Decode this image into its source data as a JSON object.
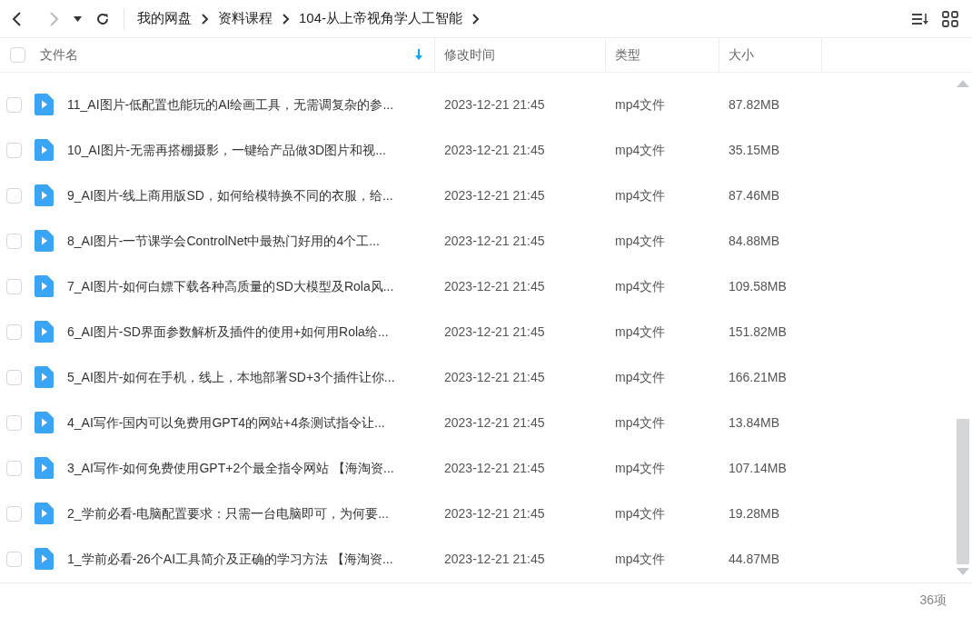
{
  "breadcrumb": [
    "我的网盘",
    "资料课程",
    "104-从上帝视角学人工智能"
  ],
  "header": {
    "checked": false,
    "columns": [
      "文件名",
      "修改时间",
      "类型",
      "大小"
    ]
  },
  "rows": [
    {
      "checked": false,
      "name": "11_AI图片-低配置也能玩的AI绘画工具，无需调复杂的参...",
      "modified": "2023-12-21 21:45",
      "type": "mp4文件",
      "size": "87.82MB"
    },
    {
      "checked": false,
      "name": "10_AI图片-无需再搭棚摄影，一键给产品做3D图片和视...",
      "modified": "2023-12-21 21:45",
      "type": "mp4文件",
      "size": "35.15MB"
    },
    {
      "checked": false,
      "name": "9_AI图片-线上商用版SD，如何给模特换不同的衣服，给...",
      "modified": "2023-12-21 21:45",
      "type": "mp4文件",
      "size": "87.46MB"
    },
    {
      "checked": false,
      "name": "8_AI图片-一节课学会ControlNet中最热门好用的4个工...",
      "modified": "2023-12-21 21:45",
      "type": "mp4文件",
      "size": "84.88MB"
    },
    {
      "checked": false,
      "name": "7_AI图片-如何白嫖下载各种高质量的SD大模型及Rola风...",
      "modified": "2023-12-21 21:45",
      "type": "mp4文件",
      "size": "109.58MB"
    },
    {
      "checked": false,
      "name": "6_AI图片-SD界面参数解析及插件的使用+如何用Rola给...",
      "modified": "2023-12-21 21:45",
      "type": "mp4文件",
      "size": "151.82MB"
    },
    {
      "checked": false,
      "name": "5_AI图片-如何在手机，线上，本地部署SD+3个插件让你...",
      "modified": "2023-12-21 21:45",
      "type": "mp4文件",
      "size": "166.21MB"
    },
    {
      "checked": false,
      "name": "4_AI写作-国内可以免费用GPT4的网站+4条测试指令让...",
      "modified": "2023-12-21 21:45",
      "type": "mp4文件",
      "size": "13.84MB"
    },
    {
      "checked": false,
      "name": "3_AI写作-如何免费使用GPT+2个最全指令网站 【海淘资...",
      "modified": "2023-12-21 21:45",
      "type": "mp4文件",
      "size": "107.14MB"
    },
    {
      "checked": false,
      "name": "2_学前必看-电脑配置要求：只需一台电脑即可，为何要...",
      "modified": "2023-12-21 21:45",
      "type": "mp4文件",
      "size": "19.28MB"
    },
    {
      "checked": false,
      "name": "1_学前必看-26个AI工具简介及正确的学习方法 【海淘资...",
      "modified": "2023-12-21 21:45",
      "type": "mp4文件",
      "size": "44.87MB"
    }
  ],
  "status_bar": {
    "count": "36项"
  }
}
